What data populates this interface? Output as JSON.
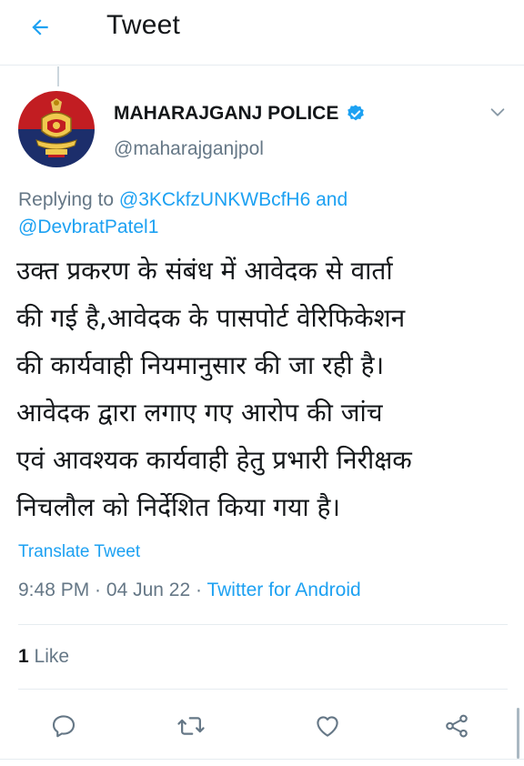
{
  "header": {
    "title": "Tweet"
  },
  "author": {
    "display_name": "MAHARAJGANJ POLICE",
    "handle": "@maharajganjpol",
    "verified": true
  },
  "reply": {
    "prefix": "Replying to ",
    "mention1": "@3KCkfzUNKWBcfH6",
    "conjunction": " and",
    "mention2": "@DevbratPatel1"
  },
  "tweet": {
    "lines": [
      "उक्त प्रकरण के संबंध में आवेदक से वार्ता",
      "की गई है,आवेदक के पासपोर्ट वेरिफिकेशन",
      "की कार्यवाही नियमानुसार की जा रही है।",
      "आवेदक द्वारा लगाए गए आरोप की जांच",
      "एवं आवश्यक कार्यवाही हेतु प्रभारी निरीक्षक",
      "निचलौल को निर्देशित किया गया है।"
    ],
    "translate_label": "Translate Tweet",
    "time": "9:48 PM",
    "separator": " · ",
    "date": "04 Jun 22",
    "source": "Twitter for Android"
  },
  "stats": {
    "likes_count": "1",
    "likes_label": " Like"
  },
  "actions": {
    "reply": "reply-icon",
    "retweet": "retweet-icon",
    "like": "heart-icon",
    "share": "share-icon"
  },
  "colors": {
    "accent": "#1da1f2",
    "secondary_text": "#657786",
    "primary_text": "#14171a",
    "divider": "#e6ecf0"
  }
}
